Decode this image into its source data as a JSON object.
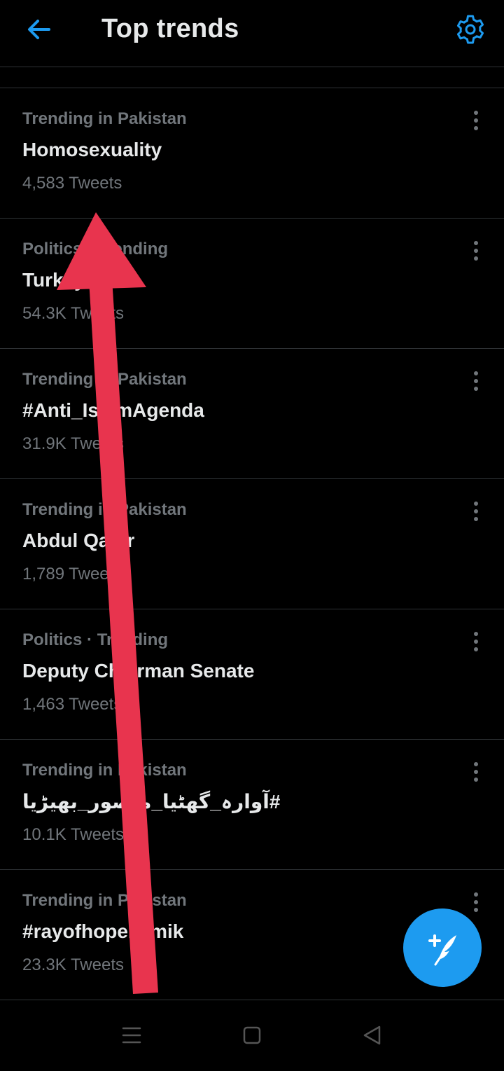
{
  "header": {
    "title": "Top trends",
    "back_icon": "arrow-left-icon",
    "settings_icon": "gear-icon",
    "accent_color": "#1d9bf0"
  },
  "trends": [
    {
      "context": "Trending in Pakistan",
      "name": "Homosexuality",
      "count": "4,583 Tweets"
    },
    {
      "context": "Politics · Trending",
      "name": "Turkey",
      "count": "54.3K Tweets"
    },
    {
      "context": "Trending in Pakistan",
      "name": "#Anti_IslamAgenda",
      "count": "31.9K Tweets"
    },
    {
      "context": "Trending in Pakistan",
      "name": "Abdul Qadir",
      "count": "1,789 Tweets"
    },
    {
      "context": "Politics · Trending",
      "name": "Deputy Chairman Senate",
      "count": "1,463 Tweets"
    },
    {
      "context": "Trending in Pakistan",
      "name": "#آوارہ_گھٹیا_منصور_بھیڑیا",
      "count": "10.1K Tweets"
    },
    {
      "context": "Trending in Pakistan",
      "name": "#rayofhopekamik",
      "count": "23.3K Tweets"
    }
  ],
  "fab": {
    "icon": "compose-tweet-icon",
    "color": "#1d9bf0"
  },
  "system_nav": {
    "icons": [
      "menu-icon",
      "home-square-icon",
      "back-triangle-icon"
    ]
  },
  "annotation": {
    "icon": "red-arrow-icon",
    "color": "#e8344e"
  }
}
